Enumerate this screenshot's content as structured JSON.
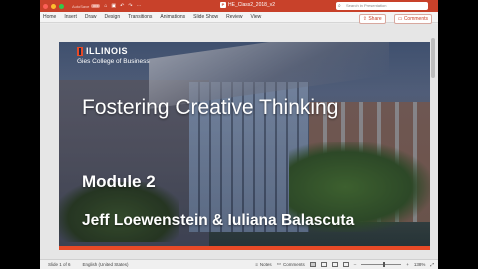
{
  "titlebar": {
    "autosave_label": "AutoSave",
    "autosave_state": "OFF",
    "document_title": "HE_Class2_2018_v2",
    "search_placeholder": "Search in Presentation"
  },
  "ribbon": {
    "tabs": [
      "Home",
      "Insert",
      "Draw",
      "Design",
      "Transitions",
      "Animations",
      "Slide Show",
      "Review",
      "View"
    ],
    "share_label": "Share",
    "comments_label": "Comments"
  },
  "slide": {
    "logo_text": "ILLINOIS",
    "logo_subtitle": "Gies College of Business",
    "title": "Fostering Creative Thinking",
    "module": "Module 2",
    "authors": "Jeff Loewenstein & Iuliana Balascuta",
    "accent_color": "#e84a27"
  },
  "statusbar": {
    "slide_indicator": "Slide 1 of 6",
    "language": "English (United States)",
    "notes_label": "Notes",
    "comments_label": "Comments",
    "zoom": "138%"
  }
}
